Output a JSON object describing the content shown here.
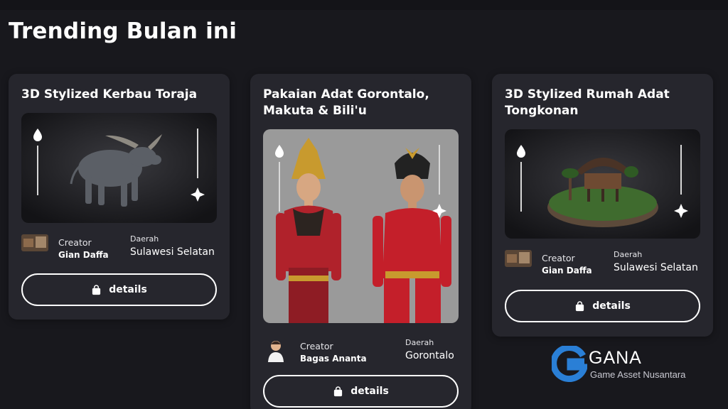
{
  "page": {
    "title": "Trending Bulan ini"
  },
  "cards": [
    {
      "title": "3D Stylized Kerbau Toraja",
      "creator_label": "Creator",
      "creator_name": "Gian Daffa",
      "region_label": "Daerah",
      "region_name": "Sulawesi Selatan",
      "button_label": "details",
      "thumbnail": "kerbau-model"
    },
    {
      "title": "Pakaian Adat Gorontalo, Makuta & Bili'u",
      "creator_label": "Creator",
      "creator_name": "Bagas Ananta",
      "region_label": "Daerah",
      "region_name": "Gorontalo",
      "button_label": "details",
      "thumbnail": "gorontalo-costume-model"
    },
    {
      "title": "3D Stylized Rumah Adat Tongkonan",
      "creator_label": "Creator",
      "creator_name": "Gian Daffa",
      "region_label": "Daerah",
      "region_name": "Sulawesi Selatan",
      "button_label": "details",
      "thumbnail": "tongkonan-model"
    }
  ],
  "branding": {
    "name": "GANA",
    "subtitle": "Game Asset Nusantara",
    "accent": "#2a7fd6"
  },
  "colors": {
    "background": "#18181d",
    "card": "#26262d"
  }
}
